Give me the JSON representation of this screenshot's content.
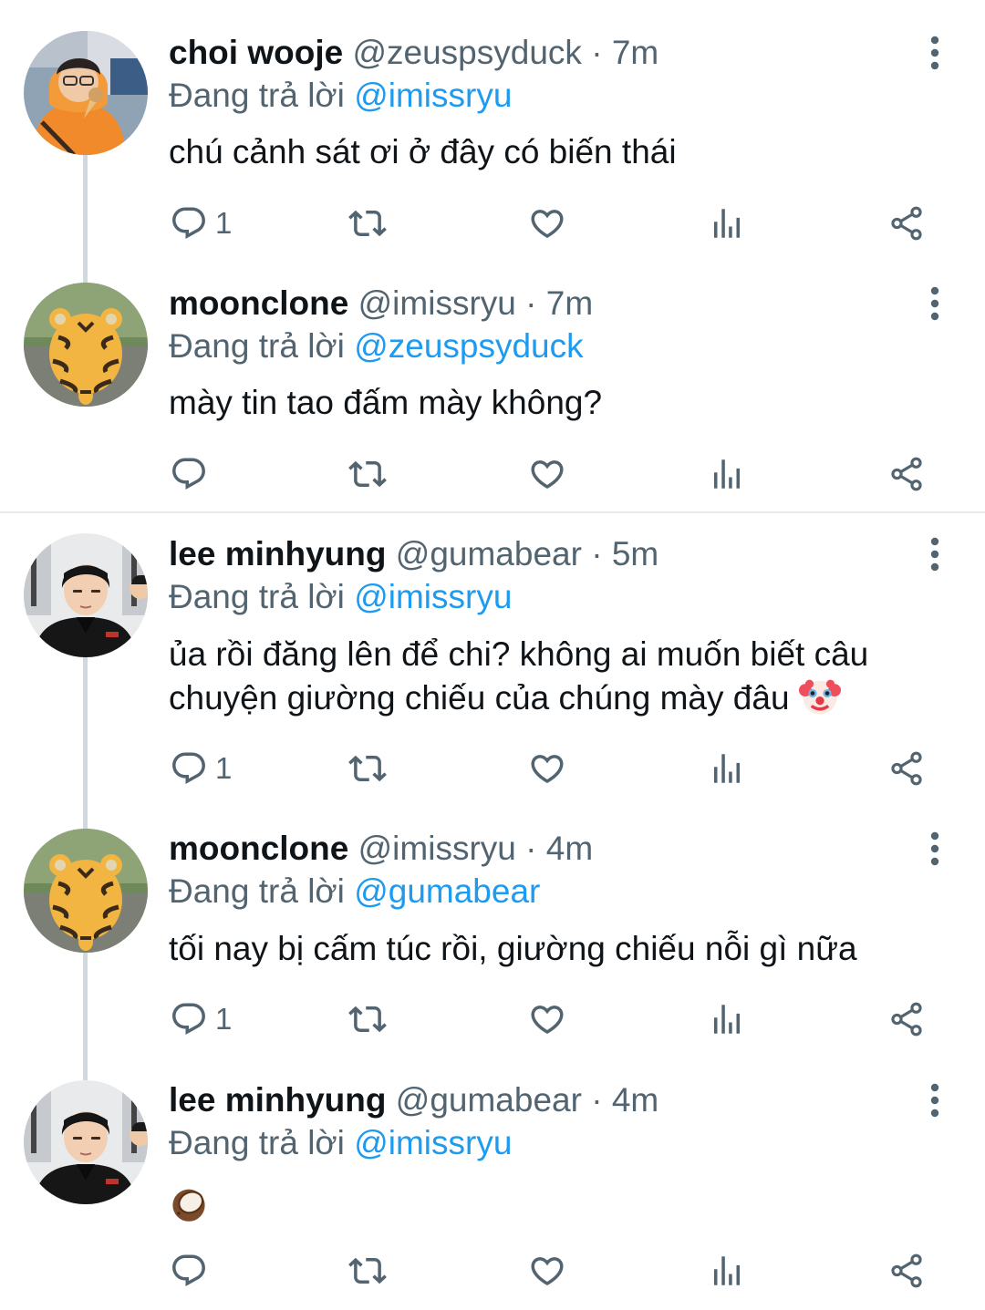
{
  "tweets": [
    {
      "name": "choi wooje",
      "handle": "@zeuspsyduck",
      "separator": "·",
      "time": "7m",
      "reply_prefix": "Đang trả lời",
      "reply_to": "@imissryu",
      "text": "chú cảnh sát ơi ở đây có biến thái",
      "reply_count": "1",
      "avatar": "orange-hoodie-photo"
    },
    {
      "name": "moonclone",
      "handle": "@imissryu",
      "separator": "·",
      "time": "7m",
      "reply_prefix": "Đang trả lời",
      "reply_to": "@zeuspsyduck",
      "text": "mày tin tao đấm mày không?",
      "reply_count": "",
      "avatar": "tiger-plush-photo"
    },
    {
      "name": "lee minhyung",
      "handle": "@gumabear",
      "separator": "·",
      "time": "5m",
      "reply_prefix": "Đang trả lời",
      "reply_to": "@imissryu",
      "text_line1": "ủa rồi đăng lên để chi? không ai muốn biết câu",
      "text_line2": "chuyện giường chiếu của chúng mày đâu",
      "text_emoji": "clown-face-emoji",
      "reply_count": "1",
      "avatar": "black-shirt-photo"
    },
    {
      "name": "moonclone",
      "handle": "@imissryu",
      "separator": "·",
      "time": "4m",
      "reply_prefix": "Đang trả lời",
      "reply_to": "@gumabear",
      "text": "tối nay bị cấm túc rồi, giường chiếu nỗi gì nữa",
      "reply_count": "1",
      "avatar": "tiger-plush-photo"
    },
    {
      "name": "lee minhyung",
      "handle": "@gumabear",
      "separator": "·",
      "time": "4m",
      "reply_prefix": "Đang trả lời",
      "reply_to": "@imissryu",
      "text_emoji": "coconut-emoji",
      "reply_count": "",
      "avatar": "black-shirt-photo"
    }
  ],
  "colors": {
    "link": "#1d9bf0",
    "secondary_text": "#536471",
    "primary_text": "#0f1419",
    "thread_line": "#cfd9de",
    "separator": "#e7e9eb"
  },
  "icons": [
    "reply-icon",
    "retweet-icon",
    "like-icon",
    "analytics-icon",
    "share-icon",
    "more-icon"
  ]
}
